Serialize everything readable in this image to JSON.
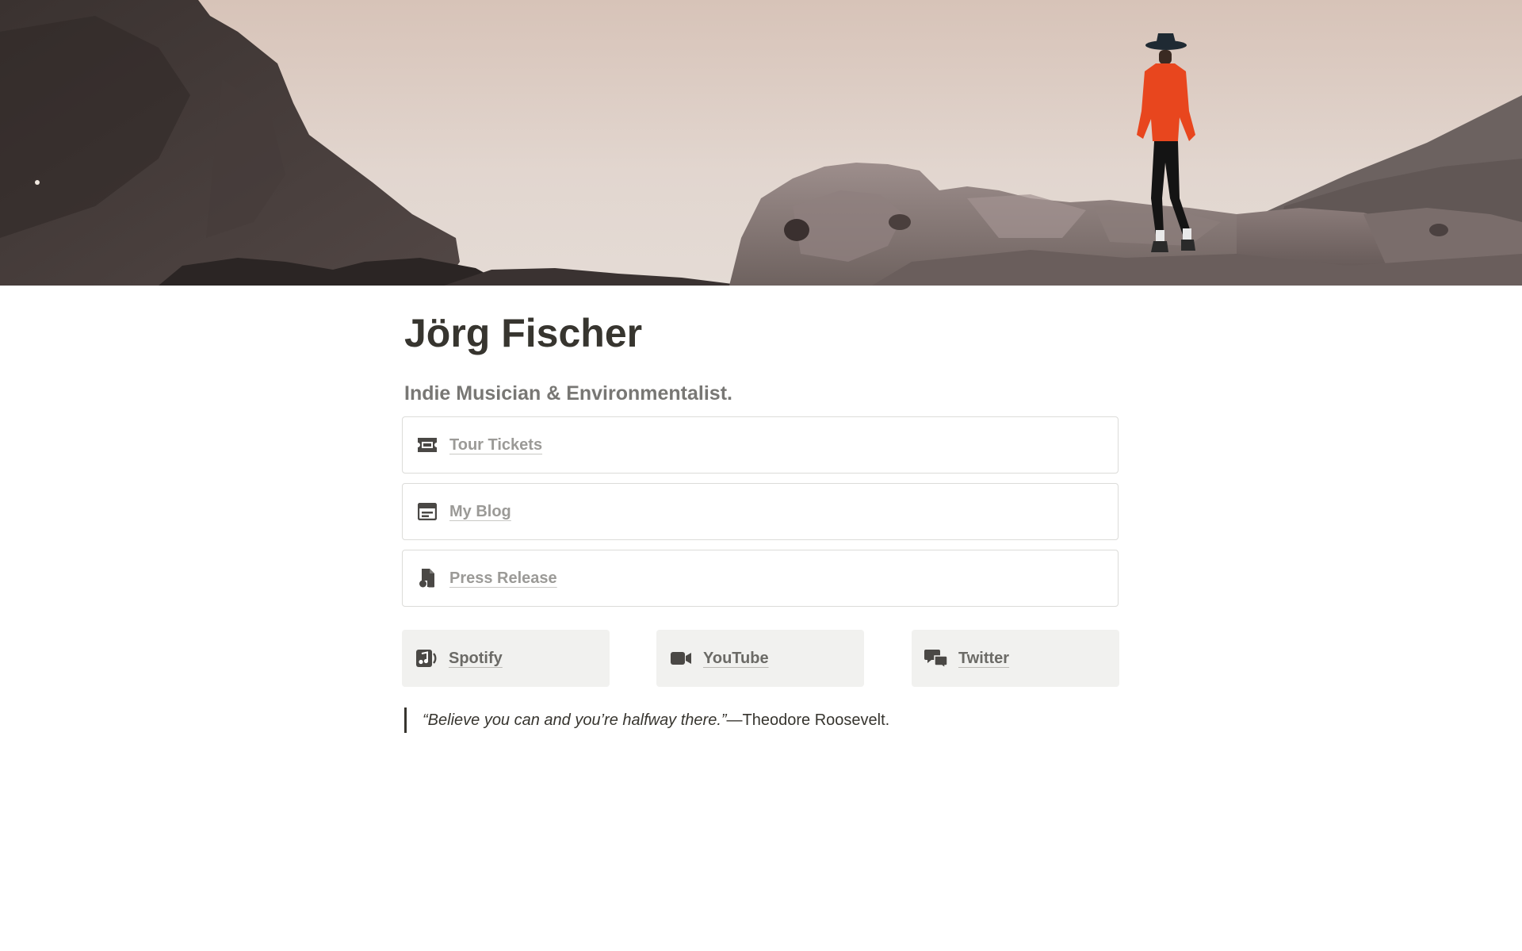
{
  "profile": {
    "name": "Jörg Fischer",
    "tagline": "Indie Musician & Environmentalist."
  },
  "links": [
    {
      "label": "Tour Tickets",
      "icon": "ticket-icon"
    },
    {
      "label": "My Blog",
      "icon": "browser-window-icon"
    },
    {
      "label": "Press Release",
      "icon": "document-shapes-icon"
    }
  ],
  "social": [
    {
      "label": "Spotify",
      "icon": "music-file-icon"
    },
    {
      "label": "YouTube",
      "icon": "video-camera-icon"
    },
    {
      "label": "Twitter",
      "icon": "chat-bubbles-icon"
    }
  ],
  "quote": {
    "text": "“Believe you can and you’re halfway there.”",
    "attribution": "—Theodore Roosevelt."
  },
  "colors": {
    "text": "#37352f",
    "muted": "#787774",
    "link": "#9b9a97",
    "card_bg": "#f1f1ef",
    "border": "#dcdcd9",
    "accent_shirt": "#e8461e"
  }
}
